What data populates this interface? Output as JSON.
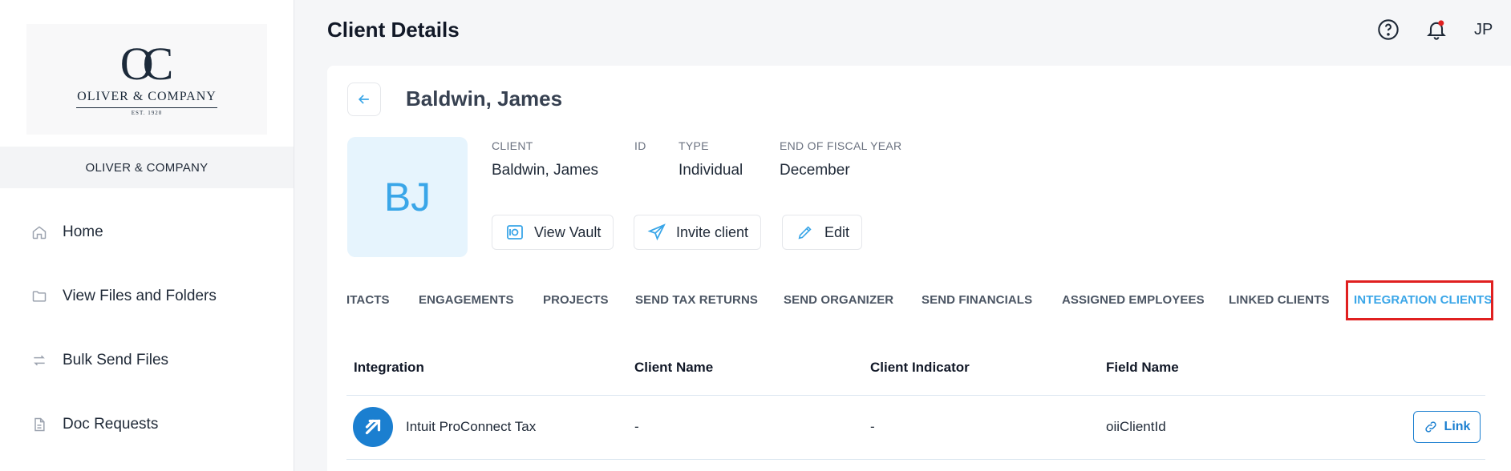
{
  "sidebar": {
    "logo": {
      "monogram": "OC",
      "name": "OLIVER & COMPANY",
      "est": "EST. 1920"
    },
    "company": "OLIVER & COMPANY",
    "items": [
      {
        "label": "Home",
        "icon": "home-icon"
      },
      {
        "label": "View Files and Folders",
        "icon": "folder-icon"
      },
      {
        "label": "Bulk Send Files",
        "icon": "transfer-icon"
      },
      {
        "label": "Doc Requests",
        "icon": "document-icon"
      }
    ]
  },
  "header": {
    "title": "Client Details",
    "help_icon": "help-circle-icon",
    "notification_icon": "bell-icon",
    "user_initials": "JP",
    "colors": {
      "notification_dot": "#e02020"
    }
  },
  "client": {
    "name": "Baldwin, James",
    "avatar_initials": "BJ",
    "fields": [
      {
        "label": "CLIENT",
        "value": "Baldwin, James"
      },
      {
        "label": "ID",
        "value": ""
      },
      {
        "label": "TYPE",
        "value": "Individual"
      },
      {
        "label": "END OF FISCAL YEAR",
        "value": "December"
      }
    ],
    "actions": [
      {
        "label": "View Vault",
        "icon": "vault-icon"
      },
      {
        "label": "Invite client",
        "icon": "send-icon"
      },
      {
        "label": "Edit",
        "icon": "pencil-icon"
      }
    ]
  },
  "tabs": [
    {
      "label": "ITACTS",
      "active": false
    },
    {
      "label": "ENGAGEMENTS",
      "active": false
    },
    {
      "label": "PROJECTS",
      "active": false
    },
    {
      "label": "SEND TAX RETURNS",
      "active": false
    },
    {
      "label": "SEND ORGANIZER",
      "active": false
    },
    {
      "label": "SEND FINANCIALS",
      "active": false
    },
    {
      "label": "ASSIGNED EMPLOYEES",
      "active": false
    },
    {
      "label": "LINKED CLIENTS",
      "active": false
    },
    {
      "label": "INTEGRATION CLIENTS",
      "active": true
    }
  ],
  "table": {
    "headers": [
      "Integration",
      "Client Name",
      "Client Indicator",
      "Field Name"
    ],
    "rows": [
      {
        "integration": "Intuit ProConnect Tax",
        "client_name": "-",
        "client_indicator": "-",
        "field_name": "oiiClientId",
        "action": "Link"
      }
    ]
  },
  "colors": {
    "accent": "#3aa6e8",
    "link": "#1b7fd0",
    "highlight": "#e02020"
  }
}
